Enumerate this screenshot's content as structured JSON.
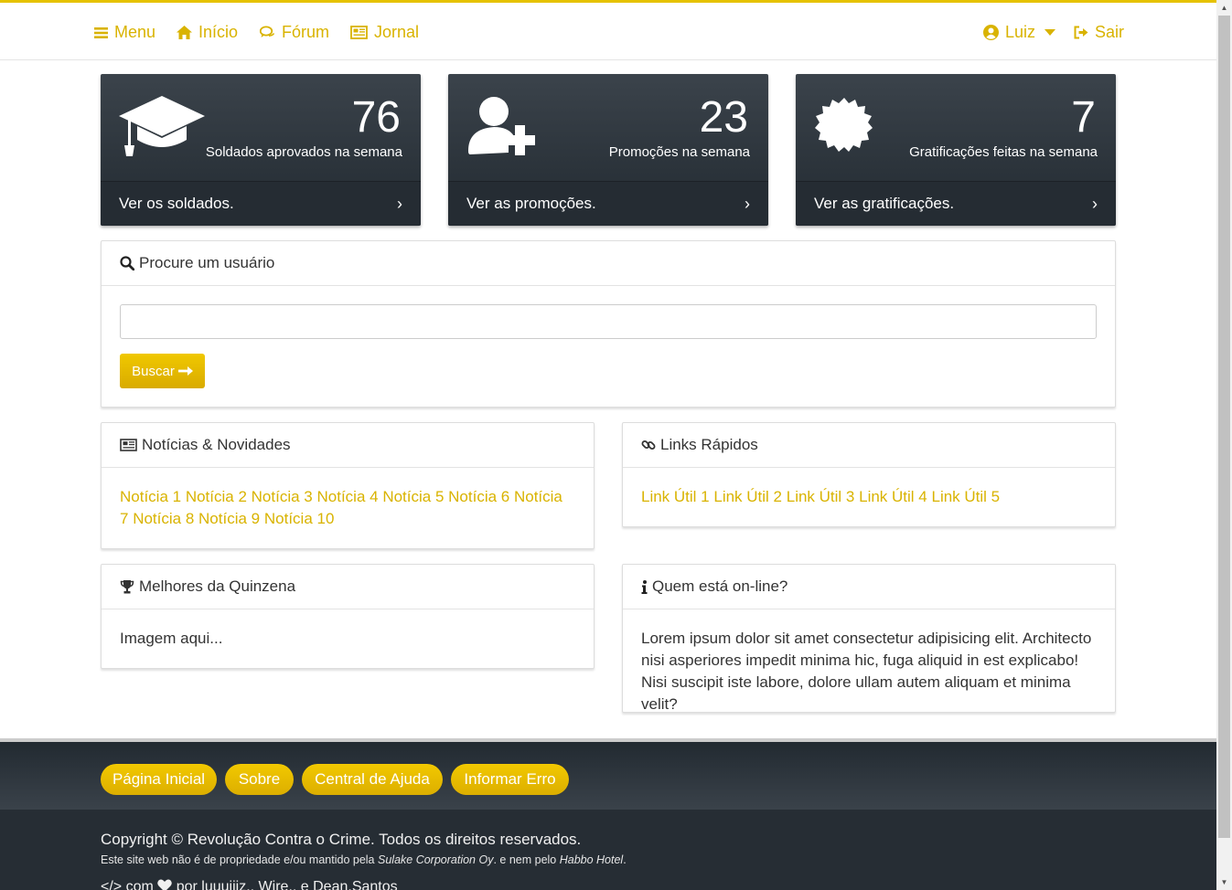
{
  "navbar": {
    "accent_color": "#e6c200",
    "items": [
      {
        "label": "Menu",
        "icon": "bars-icon"
      },
      {
        "label": "Início",
        "icon": "home-icon"
      },
      {
        "label": "Fórum",
        "icon": "comments-icon"
      },
      {
        "label": "Jornal",
        "icon": "newspaper-icon"
      }
    ],
    "user": {
      "label": "Luiz",
      "icon": "user-circle-icon"
    },
    "logout": {
      "label": "Sair",
      "icon": "sign-out-icon"
    }
  },
  "stats": [
    {
      "number": "76",
      "label": "Soldados aprovados na semana",
      "link": "Ver os soldados.",
      "icon": "graduation-cap-icon"
    },
    {
      "number": "23",
      "label": "Promoções na semana",
      "link": "Ver as promoções.",
      "icon": "user-plus-icon"
    },
    {
      "number": "7",
      "label": "Gratificações feitas na semana",
      "link": "Ver as gratificações.",
      "icon": "certificate-icon"
    }
  ],
  "search": {
    "title": "Procure um usuário",
    "placeholder": "",
    "button_label": "Buscar"
  },
  "news": {
    "title": "Notícias & Novidades",
    "items": [
      "Notícia 1",
      "Notícia 2",
      "Notícia 3",
      "Notícia 4",
      "Notícia 5",
      "Notícia 6",
      "Notícia 7",
      "Notícia 8",
      "Notícia 9",
      "Notícia 10"
    ]
  },
  "quick_links": {
    "title": "Links Rápidos",
    "items": [
      "Link Útil 1",
      "Link Útil 2",
      "Link Útil 3",
      "Link Útil 4",
      "Link Útil 5"
    ]
  },
  "best": {
    "title": "Melhores da Quinzena",
    "body": "Imagem aqui..."
  },
  "online": {
    "title": "Quem está on-line?",
    "body": "Lorem ipsum dolor sit amet consectetur adipisicing elit. Architecto nisi asperiores impedit minima hic, fuga aliquid in est explicabo! Nisi suscipit iste labore, dolore ullam autem aliquam et minima velit?"
  },
  "footer": {
    "buttons": [
      "Página Inicial",
      "Sobre",
      "Central de Ajuda",
      "Informar Erro"
    ],
    "copyright": "Copyright © Revolução Contra o Crime. Todos os direitos reservados.",
    "disclaimer_prefix": "Este site web não é de propriedade e/ou mantido pela ",
    "disclaimer_company": "Sulake Corporation Oy",
    "disclaimer_middle": ". e nem pelo ",
    "disclaimer_hotel": "Habbo Hotel",
    "disclaimer_suffix": ".",
    "credits_code": "</>",
    "credits_com": "com",
    "credits_rest": "por luuuiiiz., Wire., e Dean.Santos"
  }
}
